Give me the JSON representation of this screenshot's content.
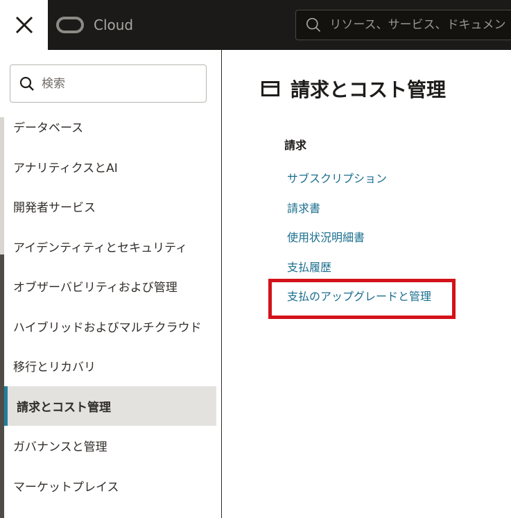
{
  "topbar": {
    "brand": "Cloud",
    "search_placeholder": "リソース、サービス、ドキュメン"
  },
  "sidebar": {
    "search_placeholder": "検索",
    "items": [
      {
        "label": "データベース"
      },
      {
        "label": "アナリティクスとAI"
      },
      {
        "label": "開発者サービス"
      },
      {
        "label": "アイデンティティとセキュリティ"
      },
      {
        "label": "オブザーバビリティおよび管理"
      },
      {
        "label": "ハイブリッドおよびマルチクラウド"
      },
      {
        "label": "移行とリカバリ"
      },
      {
        "label": "請求とコスト管理",
        "active": true
      },
      {
        "label": "ガバナンスと管理"
      },
      {
        "label": "マーケットプレイス"
      }
    ]
  },
  "main": {
    "title": "請求とコスト管理",
    "section_heading": "請求",
    "links": [
      {
        "label": "サブスクリプション"
      },
      {
        "label": "請求書"
      },
      {
        "label": "使用状況明細書"
      },
      {
        "label": "支払履歴"
      },
      {
        "label": "支払のアップグレードと管理",
        "highlighted": true
      }
    ]
  },
  "colors": {
    "topbar_bg": "#1c1a18",
    "link": "#1a6e8e",
    "active_indicator": "#227e9e",
    "highlight_border": "#d3121a"
  },
  "icons": {
    "close": "close-icon",
    "logo": "oracle-logo-icon",
    "search": "search-icon",
    "page": "card-icon"
  }
}
